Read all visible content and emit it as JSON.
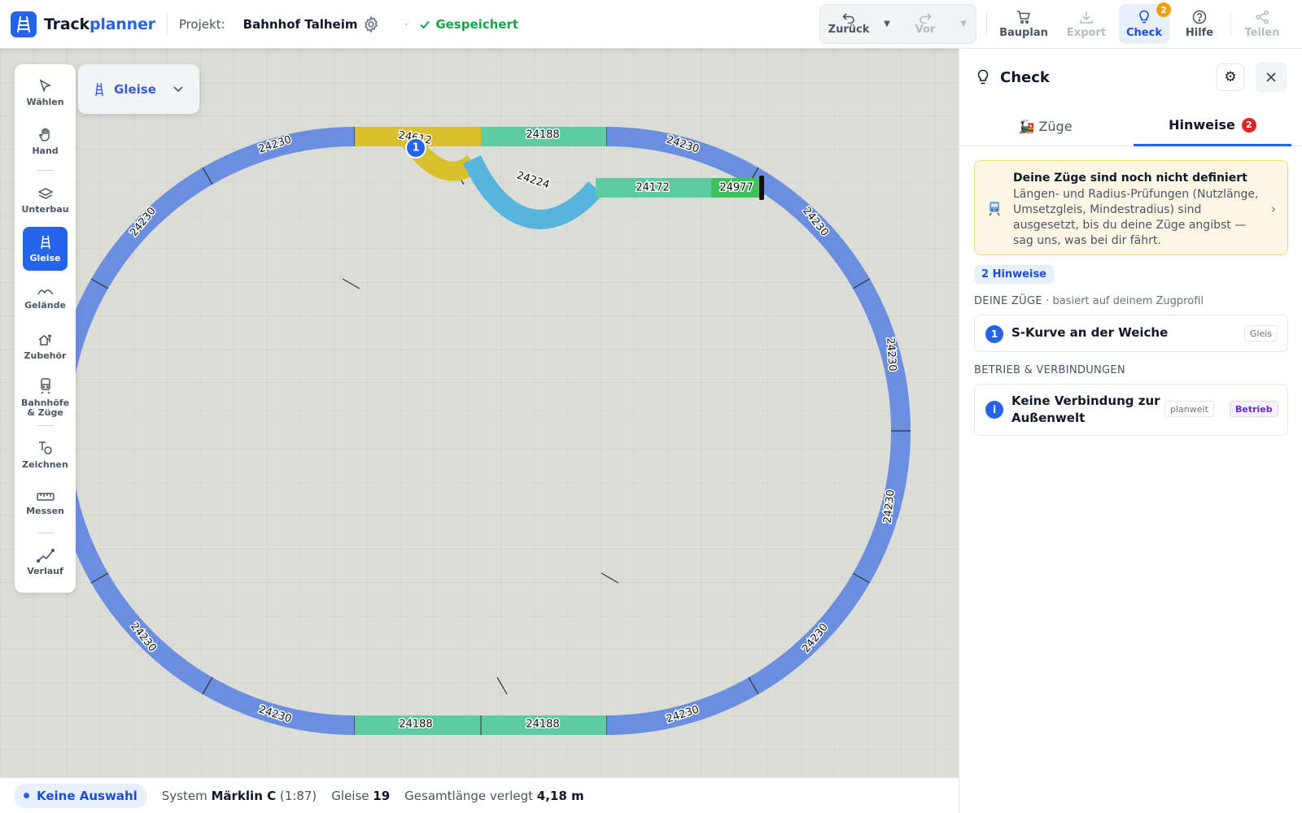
{
  "app": {
    "name_part1": "Track",
    "name_part2": "planner"
  },
  "project": {
    "label": "Projekt:",
    "name": "Bahnhof Talheim",
    "status": "Gespeichert"
  },
  "toolbar": {
    "undo_label": "Zurück",
    "redo_label": "Vor",
    "buttons": [
      {
        "label": "Bauplan",
        "icon": "cart-icon"
      },
      {
        "label": "Export",
        "icon": "download-icon"
      },
      {
        "label": "Check",
        "icon": "lightbulb-icon",
        "badge": "2"
      },
      {
        "label": "Hilfe",
        "icon": "help-icon"
      },
      {
        "label": "Teilen",
        "icon": "share-icon"
      }
    ]
  },
  "tools": [
    {
      "label": "Wählen",
      "icon": "cursor-icon"
    },
    {
      "label": "Hand",
      "icon": "hand-icon"
    },
    {
      "label": "Unterbau",
      "icon": "layers-icon"
    },
    {
      "label": "Gleise",
      "icon": "track-icon"
    },
    {
      "label": "Gelände",
      "icon": "terrain-icon"
    },
    {
      "label": "Zubehör",
      "icon": "accessory-icon"
    },
    {
      "label": "Bahnhöfe & Züge",
      "icon": "station-icon"
    },
    {
      "label": "Zeichnen",
      "icon": "draw-icon"
    },
    {
      "label": "Messen",
      "icon": "ruler-icon"
    },
    {
      "label": "Verlauf",
      "icon": "history-icon"
    }
  ],
  "layer_picker": {
    "label": "Gleise"
  },
  "track": {
    "labels": [
      "24230",
      "24230",
      "24230",
      "24230",
      "24230",
      "24230",
      "24230",
      "24230",
      "24230",
      "24230",
      "24230",
      "24230",
      "24188",
      "24188",
      "24188",
      "24612",
      "24224",
      "24172",
      "24977"
    ],
    "marker": "1",
    "colors": {
      "curve": "#6b8fe0",
      "straight": "#5ccc9f",
      "switch": "#d9c12e",
      "scurve": "#55b5dc",
      "end": "#3ec25c"
    }
  },
  "statusbar": {
    "selection": "Keine Auswahl",
    "system_label": "System",
    "system_value": "Märklin C",
    "system_scale": "(1:87)",
    "tracks_label": "Gleise",
    "tracks_value": "19",
    "length_label": "Gesamtlänge verlegt",
    "length_value": "4,18 m"
  },
  "panel": {
    "title": "Check",
    "tabs": [
      {
        "label": "🚂 Züge"
      },
      {
        "label": "Hinweise",
        "badge": "2"
      }
    ],
    "warning": {
      "title": "Deine Züge sind noch nicht definiert",
      "text": "Längen- und Radius-Prüfungen (Nutzlänge, Umsetzgleis, Mindestradius) sind ausgesetzt, bis du deine Züge angibst — sag uns, was bei dir fährt."
    },
    "count": "2 Hinweise",
    "section1": {
      "title": "DEINE ZÜGE",
      "subtitle": "· basiert auf deinem Zugprofil"
    },
    "hint1": {
      "num": "1",
      "title": "S-Kurve an der Weiche",
      "tag": "Gleis"
    },
    "section2": {
      "title": "BETRIEB & VERBINDUNGEN"
    },
    "hint2": {
      "num": "i",
      "title_line1": "Keine Verbindung zur",
      "title_line2": "Außenwelt",
      "tag1": "planweit",
      "tag2": "Betrieb"
    }
  }
}
